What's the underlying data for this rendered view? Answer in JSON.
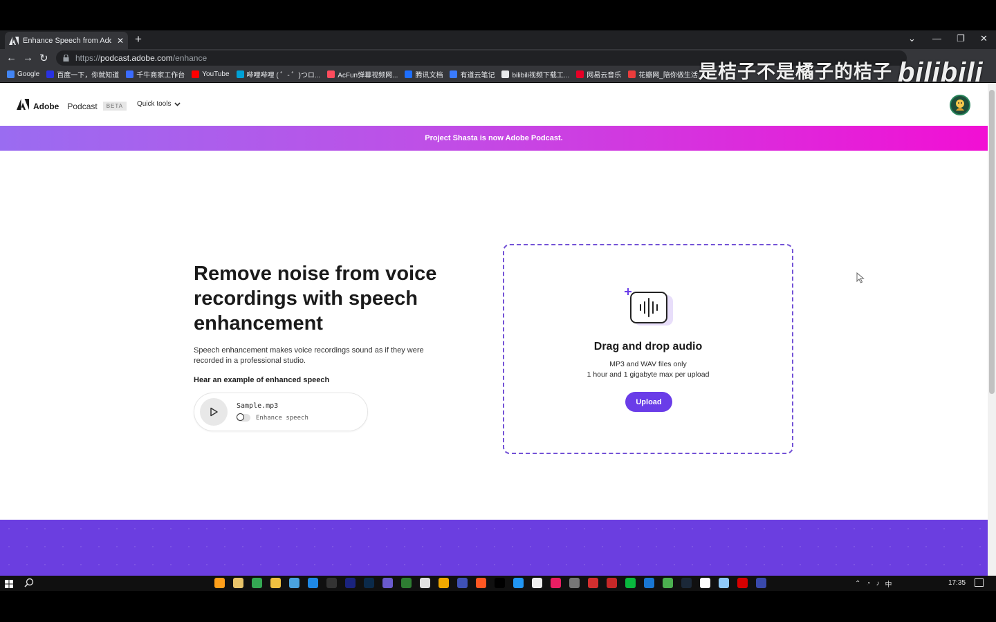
{
  "browser": {
    "tab_title": "Enhance Speech from Adobe |",
    "tab_close": "✕",
    "new_tab": "+",
    "url_scheme": "https://",
    "url_host": "podcast.adobe.com",
    "url_path": "/enhance",
    "bookmarks": [
      {
        "label": "Google",
        "color": "#4285f4"
      },
      {
        "label": "百度一下，你就知道",
        "color": "#2932e1"
      },
      {
        "label": "千牛商家工作台",
        "color": "#3b6cff"
      },
      {
        "label": "YouTube",
        "color": "#ff0000"
      },
      {
        "label": "哔哩哔哩 ( ゜- ゜)つロ...",
        "color": "#00a1d6"
      },
      {
        "label": "AcFun弹幕视频网...",
        "color": "#fd4c5d"
      },
      {
        "label": "腾讯文档",
        "color": "#1e6fff"
      },
      {
        "label": "有道云笔记",
        "color": "#3a7bfd"
      },
      {
        "label": "bilibili视频下载工...",
        "color": "#e8eaed"
      },
      {
        "label": "网易云音乐",
        "color": "#e60026"
      },
      {
        "label": "花瓣网_陪你做生活...",
        "color": "#ea3c3c"
      }
    ]
  },
  "watermark": {
    "text": "是桔子不是橘子的桔子",
    "brand": "bilibili"
  },
  "app": {
    "brand": "Adobe",
    "product": "Podcast",
    "beta": "BETA",
    "quick_tools": "Quick tools",
    "banner": "Project Shasta is now Adobe Podcast."
  },
  "hero": {
    "title": "Remove noise from voice recordings with speech enhancement",
    "description": "Speech enhancement makes voice recordings sound as if they were recorded in a professional studio.",
    "example_label": "Hear an example of enhanced speech",
    "sample_file": "Sample.mp3",
    "enhance_toggle_label": "Enhance speech"
  },
  "dropzone": {
    "title": "Drag and drop audio",
    "subtitle_1": "MP3 and WAV files only",
    "subtitle_2": "1 hour and 1 gigabyte max per upload",
    "upload_label": "Upload"
  },
  "taskbar": {
    "time": "17:35",
    "ime": "中",
    "apps": [
      "#ff9f1a",
      "#e9c46a",
      "#34a853",
      "#f0c040",
      "#4aa3df",
      "#1e88e5",
      "#333333",
      "#1a237e",
      "#0b2a4a",
      "#6a5acd",
      "#2e7d32",
      "#e0e0e0",
      "#f2a900",
      "#3f51b5",
      "#ff5722",
      "#000000",
      "#2196f3",
      "#eeeeee",
      "#e91e63",
      "#777777",
      "#d32f2f",
      "#c62828",
      "#09b83e",
      "#1976d2",
      "#4caf50",
      "#1b2838",
      "#ffffff",
      "#90caf9",
      "#d50000",
      "#3949ab"
    ]
  },
  "colors": {
    "accent": "#6a3de8",
    "dashed_border": "#7352d6",
    "banner_start": "#9a6cf1",
    "banner_end": "#f20fd4"
  }
}
